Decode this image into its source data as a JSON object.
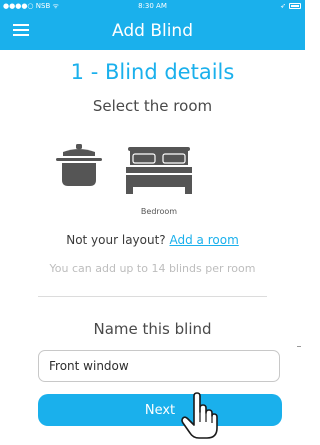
{
  "status_bar": {
    "carrier": "●●●●○ NSB ᯤ",
    "time": "8:30 AM",
    "location_glyph": "➶"
  },
  "nav": {
    "title": "Add Blind",
    "menu_icon": "hamburger-menu-icon"
  },
  "main": {
    "step_title": "1 - Blind details",
    "room_heading": "Select the room",
    "rooms": [
      {
        "icon": "cooking-pot-icon",
        "label": "",
        "selected": false
      },
      {
        "icon": "bed-icon",
        "label": "Bedroom",
        "selected": true
      }
    ],
    "layout_prompt": "Not your layout?",
    "add_room_link": "Add a room",
    "limit_hint": "You can add up to 14 blinds per room",
    "name_heading": "Name this blind",
    "name_value": "Front window",
    "next_label": "Next"
  },
  "colors": {
    "accent": "#1ab0ec",
    "icon_gray": "#555555",
    "text_dark": "#3a3a3a",
    "hint_gray": "#bdbdbd"
  }
}
